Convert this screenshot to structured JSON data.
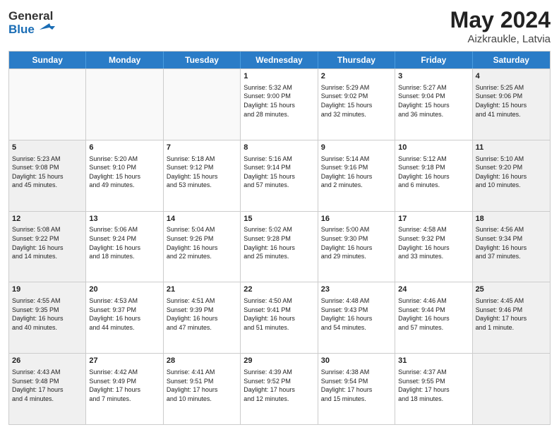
{
  "header": {
    "logo_line1": "General",
    "logo_line2": "Blue",
    "title": "May 2024",
    "location": "Aizkraukle, Latvia"
  },
  "weekdays": [
    "Sunday",
    "Monday",
    "Tuesday",
    "Wednesday",
    "Thursday",
    "Friday",
    "Saturday"
  ],
  "weeks": [
    [
      {
        "day": "",
        "info": "",
        "empty": true
      },
      {
        "day": "",
        "info": "",
        "empty": true
      },
      {
        "day": "",
        "info": "",
        "empty": true
      },
      {
        "day": "1",
        "info": "Sunrise: 5:32 AM\nSunset: 9:00 PM\nDaylight: 15 hours\nand 28 minutes.",
        "empty": false
      },
      {
        "day": "2",
        "info": "Sunrise: 5:29 AM\nSunset: 9:02 PM\nDaylight: 15 hours\nand 32 minutes.",
        "empty": false
      },
      {
        "day": "3",
        "info": "Sunrise: 5:27 AM\nSunset: 9:04 PM\nDaylight: 15 hours\nand 36 minutes.",
        "empty": false
      },
      {
        "day": "4",
        "info": "Sunrise: 5:25 AM\nSunset: 9:06 PM\nDaylight: 15 hours\nand 41 minutes.",
        "empty": false,
        "shaded": true
      }
    ],
    [
      {
        "day": "5",
        "info": "Sunrise: 5:23 AM\nSunset: 9:08 PM\nDaylight: 15 hours\nand 45 minutes.",
        "empty": false,
        "shaded": true
      },
      {
        "day": "6",
        "info": "Sunrise: 5:20 AM\nSunset: 9:10 PM\nDaylight: 15 hours\nand 49 minutes.",
        "empty": false
      },
      {
        "day": "7",
        "info": "Sunrise: 5:18 AM\nSunset: 9:12 PM\nDaylight: 15 hours\nand 53 minutes.",
        "empty": false
      },
      {
        "day": "8",
        "info": "Sunrise: 5:16 AM\nSunset: 9:14 PM\nDaylight: 15 hours\nand 57 minutes.",
        "empty": false
      },
      {
        "day": "9",
        "info": "Sunrise: 5:14 AM\nSunset: 9:16 PM\nDaylight: 16 hours\nand 2 minutes.",
        "empty": false
      },
      {
        "day": "10",
        "info": "Sunrise: 5:12 AM\nSunset: 9:18 PM\nDaylight: 16 hours\nand 6 minutes.",
        "empty": false
      },
      {
        "day": "11",
        "info": "Sunrise: 5:10 AM\nSunset: 9:20 PM\nDaylight: 16 hours\nand 10 minutes.",
        "empty": false,
        "shaded": true
      }
    ],
    [
      {
        "day": "12",
        "info": "Sunrise: 5:08 AM\nSunset: 9:22 PM\nDaylight: 16 hours\nand 14 minutes.",
        "empty": false,
        "shaded": true
      },
      {
        "day": "13",
        "info": "Sunrise: 5:06 AM\nSunset: 9:24 PM\nDaylight: 16 hours\nand 18 minutes.",
        "empty": false
      },
      {
        "day": "14",
        "info": "Sunrise: 5:04 AM\nSunset: 9:26 PM\nDaylight: 16 hours\nand 22 minutes.",
        "empty": false
      },
      {
        "day": "15",
        "info": "Sunrise: 5:02 AM\nSunset: 9:28 PM\nDaylight: 16 hours\nand 25 minutes.",
        "empty": false
      },
      {
        "day": "16",
        "info": "Sunrise: 5:00 AM\nSunset: 9:30 PM\nDaylight: 16 hours\nand 29 minutes.",
        "empty": false
      },
      {
        "day": "17",
        "info": "Sunrise: 4:58 AM\nSunset: 9:32 PM\nDaylight: 16 hours\nand 33 minutes.",
        "empty": false
      },
      {
        "day": "18",
        "info": "Sunrise: 4:56 AM\nSunset: 9:34 PM\nDaylight: 16 hours\nand 37 minutes.",
        "empty": false,
        "shaded": true
      }
    ],
    [
      {
        "day": "19",
        "info": "Sunrise: 4:55 AM\nSunset: 9:35 PM\nDaylight: 16 hours\nand 40 minutes.",
        "empty": false,
        "shaded": true
      },
      {
        "day": "20",
        "info": "Sunrise: 4:53 AM\nSunset: 9:37 PM\nDaylight: 16 hours\nand 44 minutes.",
        "empty": false
      },
      {
        "day": "21",
        "info": "Sunrise: 4:51 AM\nSunset: 9:39 PM\nDaylight: 16 hours\nand 47 minutes.",
        "empty": false
      },
      {
        "day": "22",
        "info": "Sunrise: 4:50 AM\nSunset: 9:41 PM\nDaylight: 16 hours\nand 51 minutes.",
        "empty": false
      },
      {
        "day": "23",
        "info": "Sunrise: 4:48 AM\nSunset: 9:43 PM\nDaylight: 16 hours\nand 54 minutes.",
        "empty": false
      },
      {
        "day": "24",
        "info": "Sunrise: 4:46 AM\nSunset: 9:44 PM\nDaylight: 16 hours\nand 57 minutes.",
        "empty": false
      },
      {
        "day": "25",
        "info": "Sunrise: 4:45 AM\nSunset: 9:46 PM\nDaylight: 17 hours\nand 1 minute.",
        "empty": false,
        "shaded": true
      }
    ],
    [
      {
        "day": "26",
        "info": "Sunrise: 4:43 AM\nSunset: 9:48 PM\nDaylight: 17 hours\nand 4 minutes.",
        "empty": false,
        "shaded": true
      },
      {
        "day": "27",
        "info": "Sunrise: 4:42 AM\nSunset: 9:49 PM\nDaylight: 17 hours\nand 7 minutes.",
        "empty": false
      },
      {
        "day": "28",
        "info": "Sunrise: 4:41 AM\nSunset: 9:51 PM\nDaylight: 17 hours\nand 10 minutes.",
        "empty": false
      },
      {
        "day": "29",
        "info": "Sunrise: 4:39 AM\nSunset: 9:52 PM\nDaylight: 17 hours\nand 12 minutes.",
        "empty": false
      },
      {
        "day": "30",
        "info": "Sunrise: 4:38 AM\nSunset: 9:54 PM\nDaylight: 17 hours\nand 15 minutes.",
        "empty": false
      },
      {
        "day": "31",
        "info": "Sunrise: 4:37 AM\nSunset: 9:55 PM\nDaylight: 17 hours\nand 18 minutes.",
        "empty": false
      },
      {
        "day": "",
        "info": "",
        "empty": true,
        "shaded": true
      }
    ]
  ]
}
